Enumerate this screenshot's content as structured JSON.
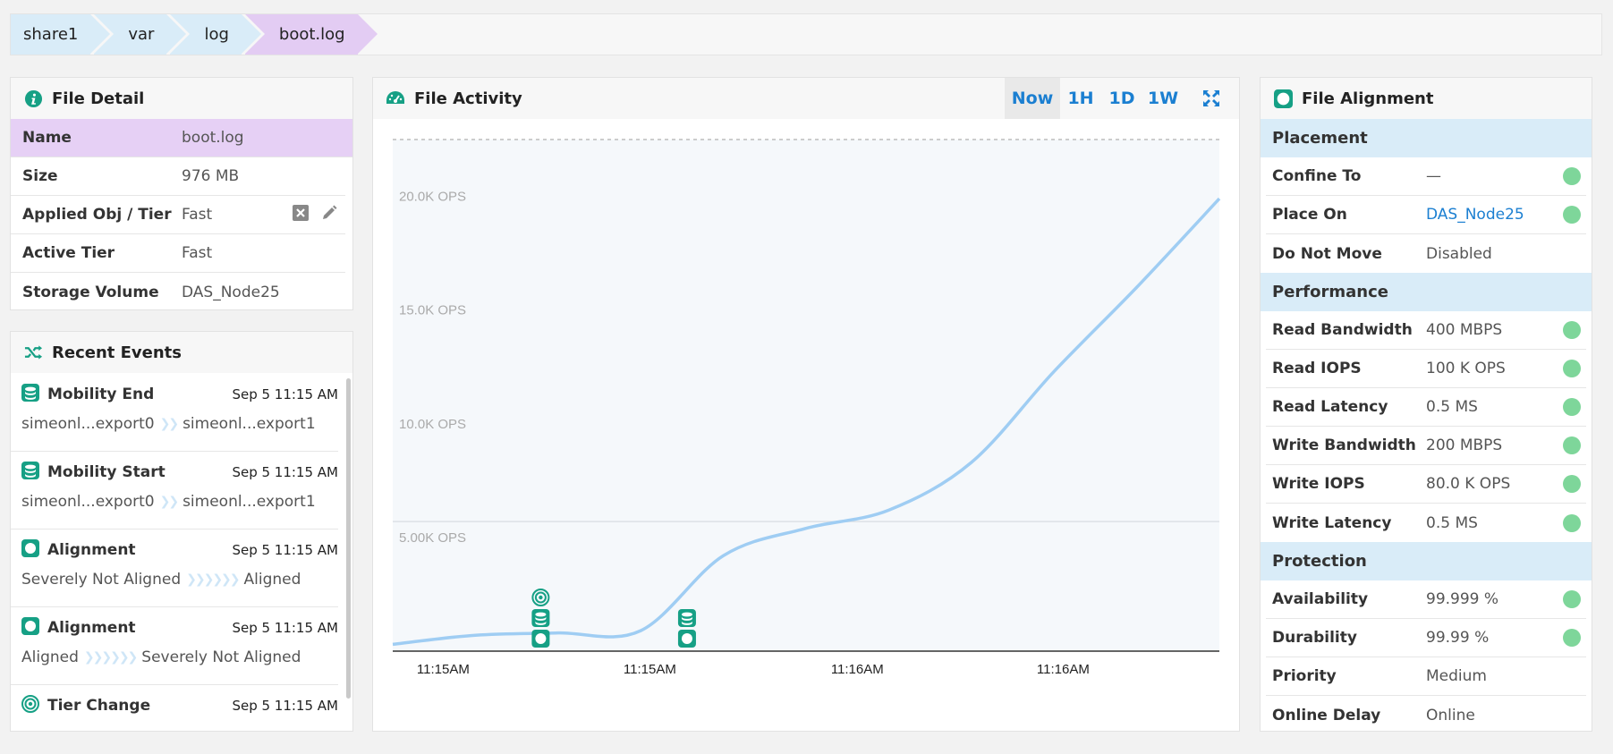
{
  "breadcrumb": [
    "share1",
    "var",
    "log",
    "boot.log"
  ],
  "file_detail": {
    "title": "File Detail",
    "rows": [
      {
        "key": "Name",
        "value": "boot.log"
      },
      {
        "key": "Size",
        "value": "976 MB"
      },
      {
        "key": "Applied Obj / Tier",
        "value": "Fast"
      },
      {
        "key": "Active Tier",
        "value": "Fast"
      },
      {
        "key": "Storage Volume",
        "value": "DAS_Node25"
      }
    ]
  },
  "recent_events": {
    "title": "Recent Events",
    "items": [
      {
        "title": "Mobility End",
        "time": "Sep 5 11:15 AM",
        "from": "simeonl...export0",
        "to": "simeonl...export1",
        "icon": "database-icon",
        "chevrons": "❯❯"
      },
      {
        "title": "Mobility Start",
        "time": "Sep 5 11:15 AM",
        "from": "simeonl...export0",
        "to": "simeonl...export1",
        "icon": "database-icon",
        "chevrons": "❯❯"
      },
      {
        "title": "Alignment",
        "time": "Sep 5 11:15 AM",
        "from": "Severely Not Aligned",
        "to": "Aligned",
        "icon": "alignment-icon",
        "chevrons": "❯❯❯❯❯❯"
      },
      {
        "title": "Alignment",
        "time": "Sep 5 11:15 AM",
        "from": "Aligned",
        "to": "Severely Not Aligned",
        "icon": "alignment-icon",
        "chevrons": "❯❯❯❯❯❯"
      },
      {
        "title": "Tier Change",
        "time": "Sep 5 11:15 AM",
        "from": "",
        "to": "",
        "icon": "target-icon",
        "chevrons": ""
      }
    ]
  },
  "file_activity": {
    "title": "File Activity",
    "time_buttons": [
      "Now",
      "1H",
      "1D",
      "1W"
    ],
    "active_button": "Now"
  },
  "chart_data": {
    "type": "line",
    "title": "",
    "xlabel": "",
    "ylabel": "",
    "ylim": [
      0,
      22500
    ],
    "y_ticks": [
      5000,
      10000,
      15000,
      20000
    ],
    "y_tick_labels": [
      "5.00K OPS",
      "10.0K OPS",
      "15.0K OPS",
      "20.0K OPS"
    ],
    "x_tick_labels": [
      "11:15AM",
      "11:15AM",
      "11:16AM",
      "11:16AM"
    ],
    "series": [
      {
        "values": [
          300,
          700,
          800,
          900,
          4200,
          5400,
          6200,
          8300,
          12300,
          16000,
          19900
        ]
      }
    ],
    "grid": true,
    "line_color": "#9fcdf3"
  },
  "file_alignment": {
    "title": "File Alignment",
    "sections": [
      {
        "name": "Placement",
        "rows": [
          {
            "key": "Confine To",
            "value": "—",
            "status": true
          },
          {
            "key": "Place On",
            "value": "DAS_Node25",
            "status": true,
            "link": true
          },
          {
            "key": "Do Not Move",
            "value": "Disabled",
            "status": false
          }
        ]
      },
      {
        "name": "Performance",
        "rows": [
          {
            "key": "Read Bandwidth",
            "value": "400 MBPS",
            "status": true
          },
          {
            "key": "Read IOPS",
            "value": "100 K OPS",
            "status": true
          },
          {
            "key": "Read Latency",
            "value": "0.5 MS",
            "status": true
          },
          {
            "key": "Write Bandwidth",
            "value": "200 MBPS",
            "status": true
          },
          {
            "key": "Write IOPS",
            "value": "80.0 K OPS",
            "status": true
          },
          {
            "key": "Write Latency",
            "value": "0.5 MS",
            "status": true
          }
        ]
      },
      {
        "name": "Protection",
        "rows": [
          {
            "key": "Availability",
            "value": "99.999 %",
            "status": true
          },
          {
            "key": "Durability",
            "value": "99.99 %",
            "status": true
          },
          {
            "key": "Priority",
            "value": "Medium",
            "status": false
          },
          {
            "key": "Online Delay",
            "value": "Online",
            "status": false
          }
        ]
      }
    ]
  },
  "colors": {
    "accent": "#1b7fd1",
    "teal": "#16a085",
    "status_ok": "#7ed69a"
  }
}
